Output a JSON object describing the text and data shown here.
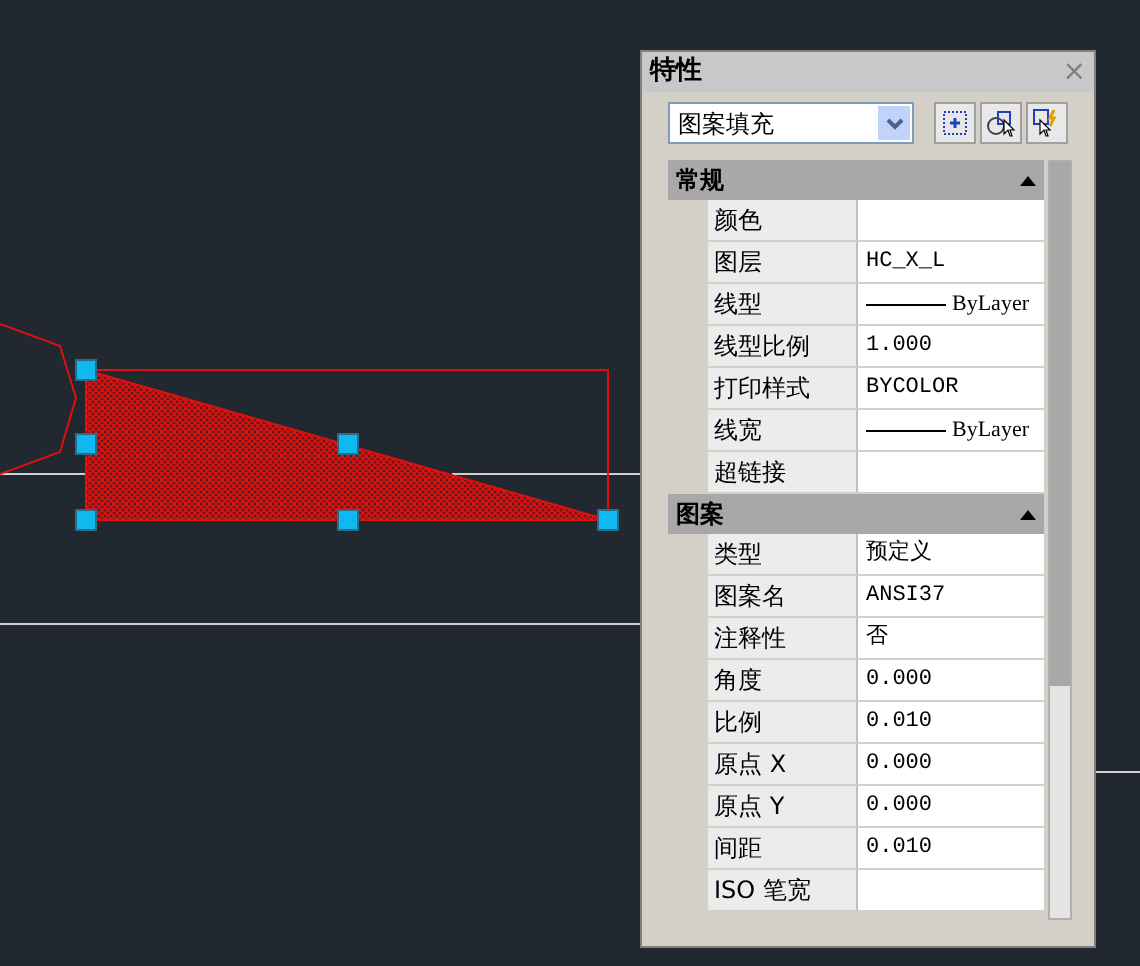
{
  "palette": {
    "title": "特性",
    "close": "×",
    "object_type": "图案填充"
  },
  "sections": [
    {
      "title": "常规",
      "expanded": true,
      "rows": [
        {
          "label": "颜色",
          "value": "",
          "kind": "text"
        },
        {
          "label": "图层",
          "value": "HC_X_L",
          "kind": "text"
        },
        {
          "label": "线型",
          "value": "ByLayer",
          "kind": "line"
        },
        {
          "label": "线型比例",
          "value": "1.000",
          "kind": "text"
        },
        {
          "label": "打印样式",
          "value": "BYCOLOR",
          "kind": "text"
        },
        {
          "label": "线宽",
          "value": "ByLayer",
          "kind": "line"
        },
        {
          "label": "超链接",
          "value": "",
          "kind": "text"
        }
      ]
    },
    {
      "title": "图案",
      "expanded": true,
      "rows": [
        {
          "label": "类型",
          "value": "预定义",
          "kind": "text"
        },
        {
          "label": "图案名",
          "value": "ANSI37",
          "kind": "text"
        },
        {
          "label": "注释性",
          "value": "否",
          "kind": "text"
        },
        {
          "label": "角度",
          "value": "0.000",
          "kind": "text"
        },
        {
          "label": "比例",
          "value": "0.010",
          "kind": "text"
        },
        {
          "label": "原点 X",
          "value": "0.000",
          "kind": "text"
        },
        {
          "label": "原点 Y",
          "value": "0.000",
          "kind": "text"
        },
        {
          "label": "间距",
          "value": "0.010",
          "kind": "text"
        },
        {
          "label": "ISO 笔宽",
          "value": "",
          "kind": "text"
        }
      ]
    }
  ]
}
